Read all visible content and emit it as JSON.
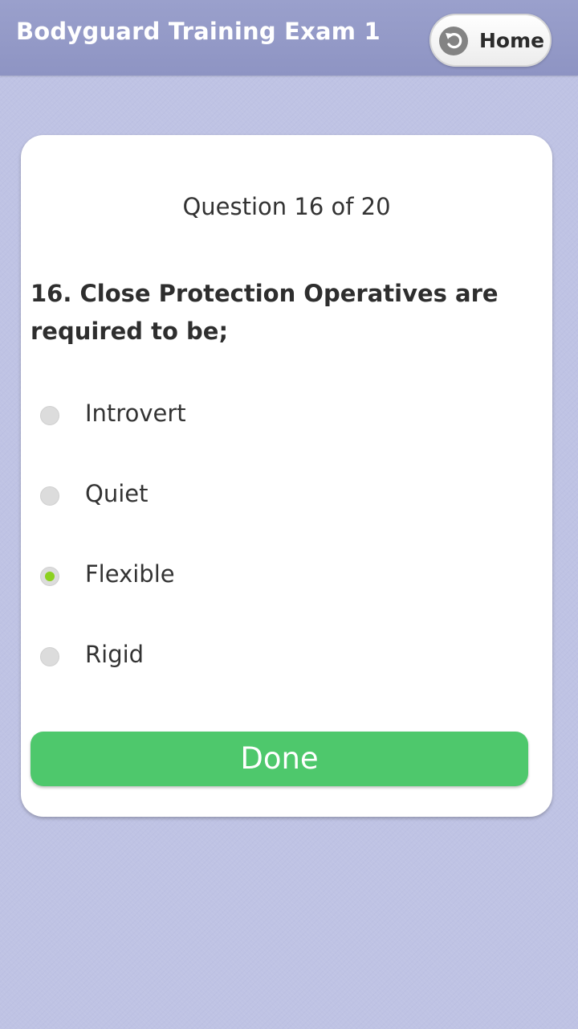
{
  "header": {
    "title": "Bodyguard Training Exam 1",
    "home_label": "Home",
    "home_icon": "undo-arrow-icon"
  },
  "quiz": {
    "counter": "Question 16 of 20",
    "question": "16. Close Protection Operatives are required to be;",
    "options": [
      {
        "label": "Introvert",
        "selected": false
      },
      {
        "label": "Quiet",
        "selected": false
      },
      {
        "label": "Flexible",
        "selected": true
      },
      {
        "label": "Rigid",
        "selected": false
      }
    ],
    "done_label": "Done"
  },
  "colors": {
    "header_bg": "#8e94c3",
    "page_bg": "#bfc3e4",
    "done_button": "#4ec86c",
    "radio_selected": "#8cd11f"
  }
}
